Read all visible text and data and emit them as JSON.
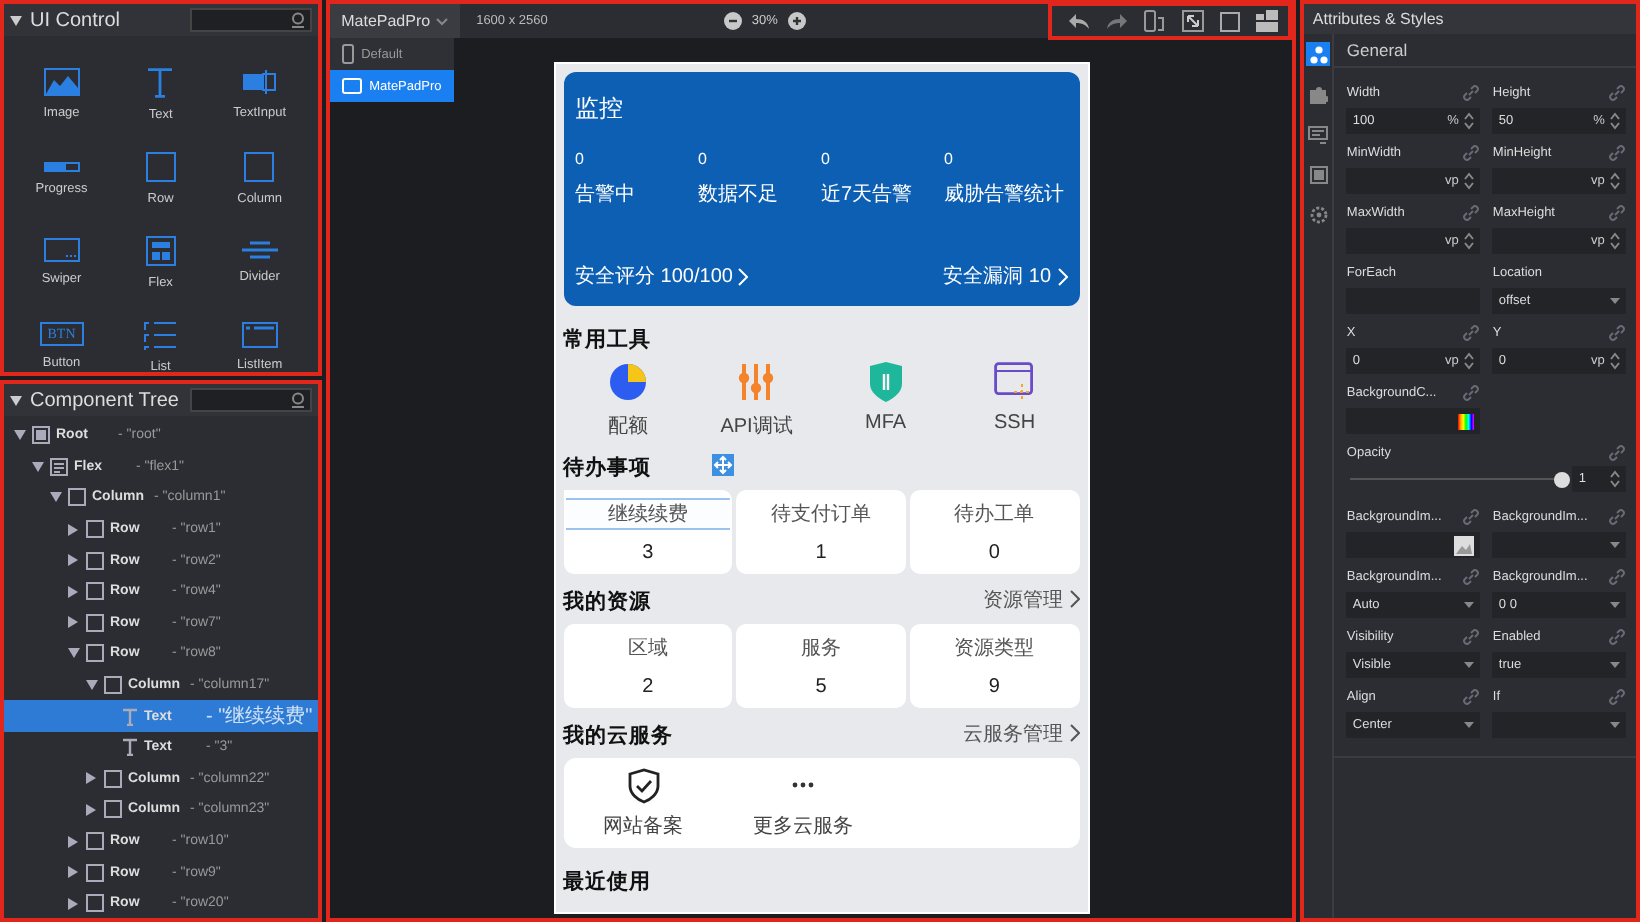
{
  "ui_control": {
    "title": "UI Control",
    "controls": [
      {
        "label": "Image",
        "kind": "image"
      },
      {
        "label": "Text",
        "kind": "text"
      },
      {
        "label": "TextInput",
        "kind": "textinput"
      },
      {
        "label": "Progress",
        "kind": "progress"
      },
      {
        "label": "Row",
        "kind": "row"
      },
      {
        "label": "Column",
        "kind": "column"
      },
      {
        "label": "Swiper",
        "kind": "swiper"
      },
      {
        "label": "Flex",
        "kind": "flex"
      },
      {
        "label": "Divider",
        "kind": "divider"
      },
      {
        "label": "Button",
        "kind": "button",
        "icon_text": "BTN"
      },
      {
        "label": "List",
        "kind": "list"
      },
      {
        "label": "ListItem",
        "kind": "listitem"
      }
    ]
  },
  "component_tree": {
    "title": "Component Tree",
    "items": [
      {
        "type": "Root",
        "kind": "root",
        "id": "- \"root\"",
        "expanded": true,
        "selected": false,
        "children": [
          {
            "type": "Flex",
            "kind": "flex",
            "id": "- \"flex1\"",
            "expanded": true,
            "selected": false,
            "children": [
              {
                "type": "Column",
                "kind": "box",
                "id": "- \"column1\"",
                "expanded": true,
                "selected": false,
                "children": [
                  {
                    "type": "Row",
                    "kind": "box",
                    "id": "- \"row1\"",
                    "expanded": false,
                    "selected": false
                  },
                  {
                    "type": "Row",
                    "kind": "box",
                    "id": "- \"row2\"",
                    "expanded": false,
                    "selected": false
                  },
                  {
                    "type": "Row",
                    "kind": "box",
                    "id": "- \"row4\"",
                    "expanded": false,
                    "selected": false
                  },
                  {
                    "type": "Row",
                    "kind": "box",
                    "id": "- \"row7\"",
                    "expanded": false,
                    "selected": false
                  },
                  {
                    "type": "Row",
                    "kind": "box",
                    "id": "- \"row8\"",
                    "expanded": true,
                    "selected": false,
                    "children": [
                      {
                        "type": "Column",
                        "kind": "box",
                        "id": "- \"column17\"",
                        "expanded": true,
                        "selected": false,
                        "children": [
                          {
                            "type": "Text",
                            "kind": "text",
                            "id": "- \"继续续费\"",
                            "selected": true
                          },
                          {
                            "type": "Text",
                            "kind": "text",
                            "id": "- \"3\"",
                            "selected": false
                          }
                        ]
                      },
                      {
                        "type": "Column",
                        "kind": "box",
                        "id": "- \"column22\"",
                        "expanded": false,
                        "selected": false
                      },
                      {
                        "type": "Column",
                        "kind": "box",
                        "id": "- \"column23\"",
                        "expanded": false,
                        "selected": false
                      }
                    ]
                  },
                  {
                    "type": "Row",
                    "kind": "box",
                    "id": "- \"row10\"",
                    "expanded": false,
                    "selected": false
                  },
                  {
                    "type": "Row",
                    "kind": "box",
                    "id": "- \"row9\"",
                    "expanded": false,
                    "selected": false
                  },
                  {
                    "type": "Row",
                    "kind": "box",
                    "id": "- \"row20\"",
                    "expanded": false,
                    "selected": false
                  }
                ]
              }
            ]
          }
        ]
      }
    ]
  },
  "editor": {
    "device": "MatePadPro",
    "resolution": "1600 x 2560",
    "zoom": "30%",
    "device_menu": [
      {
        "label": "Default",
        "kind": "phone",
        "selected": false
      },
      {
        "label": "MatePadPro",
        "kind": "tablet",
        "selected": true
      }
    ],
    "preview": {
      "monitor": {
        "title": "监控",
        "stats": [
          {
            "value": "0",
            "label": "告警中"
          },
          {
            "value": "0",
            "label": "数据不足"
          },
          {
            "value": "0",
            "label": "近7天告警"
          },
          {
            "value": "0",
            "label": "威胁告警统计"
          }
        ],
        "score": "安全评分 100/100",
        "vulnerabilities": "安全漏洞  10"
      },
      "tools": {
        "title": "常用工具",
        "items": [
          {
            "label": "配额",
            "kind": "pie"
          },
          {
            "label": "API调试",
            "kind": "sliders"
          },
          {
            "label": "MFA",
            "kind": "shield"
          },
          {
            "label": "SSH",
            "kind": "terminal"
          }
        ]
      },
      "todo": {
        "title": "待办事项",
        "cards": [
          {
            "label": "继续续费",
            "value": "3",
            "selected": true
          },
          {
            "label": "待支付订单",
            "value": "1",
            "selected": false
          },
          {
            "label": "待办工单",
            "value": "0",
            "selected": false
          }
        ]
      },
      "resources": {
        "title": "我的资源",
        "link": "资源管理",
        "cards": [
          {
            "label": "区域",
            "value": "2"
          },
          {
            "label": "服务",
            "value": "5"
          },
          {
            "label": "资源类型",
            "value": "9"
          }
        ]
      },
      "cloud": {
        "title": "我的云服务",
        "link": "云服务管理",
        "items": [
          {
            "label": "网站备案",
            "kind": "shield-check"
          },
          {
            "label": "更多云服务",
            "kind": "more"
          }
        ]
      },
      "recent": {
        "title": "最近使用"
      }
    }
  },
  "attributes": {
    "title": "Attributes & Styles",
    "tabs": [
      {
        "kind": "components",
        "selected": true
      },
      {
        "kind": "puzzle",
        "selected": false
      },
      {
        "kind": "monitor",
        "selected": false
      },
      {
        "kind": "square",
        "selected": false
      },
      {
        "kind": "gear",
        "selected": false
      }
    ],
    "section": "General",
    "fields": [
      {
        "label": "Width",
        "kind": "number",
        "value": "100",
        "unit": "%",
        "link": true
      },
      {
        "label": "Height",
        "kind": "number",
        "value": "50",
        "unit": "%",
        "link": true
      },
      {
        "label": "MinWidth",
        "kind": "number",
        "unit": "vp",
        "link": true
      },
      {
        "label": "MinHeight",
        "kind": "number",
        "unit": "vp",
        "link": true
      },
      {
        "label": "MaxWidth",
        "kind": "number",
        "unit": "vp",
        "link": true
      },
      {
        "label": "MaxHeight",
        "kind": "number",
        "unit": "vp",
        "link": true
      },
      {
        "label": "ForEach",
        "kind": "text",
        "link": false
      },
      {
        "label": "Location",
        "kind": "select",
        "value": "offset",
        "link": false
      },
      {
        "label": "X",
        "kind": "number",
        "value": "0",
        "unit": "vp",
        "link": true
      },
      {
        "label": "Y",
        "kind": "number",
        "value": "0",
        "unit": "vp",
        "link": true
      },
      {
        "label": "BackgroundC...",
        "kind": "color",
        "link": true
      },
      {
        "label": "Opacity",
        "kind": "slider",
        "level": 1,
        "value": "1",
        "link": true
      },
      {
        "label": "BackgroundIm...",
        "kind": "image",
        "link": true
      },
      {
        "label": "BackgroundIm...",
        "kind": "select",
        "link": true
      },
      {
        "label": "BackgroundIm...",
        "kind": "select",
        "value": "Auto",
        "link": true
      },
      {
        "label": "BackgroundIm...",
        "kind": "select",
        "value": "0 0",
        "link": true
      },
      {
        "label": "Visibility",
        "kind": "select",
        "value": "Visible",
        "link": true
      },
      {
        "label": "Enabled",
        "kind": "select",
        "value": "true",
        "link": true
      },
      {
        "label": "Align",
        "kind": "select",
        "value": "Center",
        "link": true
      },
      {
        "label": "If",
        "kind": "select",
        "link": true
      }
    ]
  }
}
